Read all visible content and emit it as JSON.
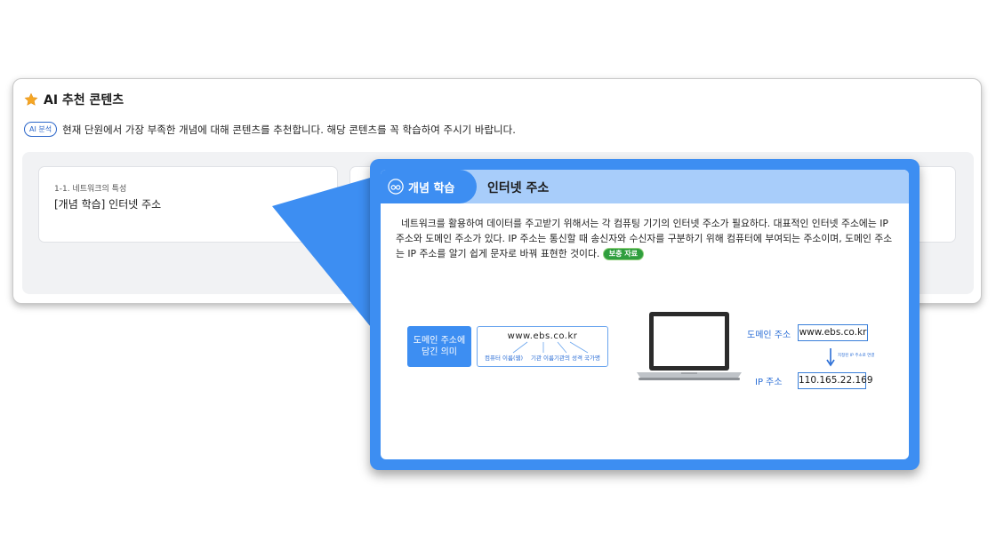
{
  "recommend": {
    "title": "AI 추천 콘텐츠",
    "badge": "AI 분석",
    "description": "현재 단원에서 가장 부족한 개념에 대해 콘텐츠를 추천합니다. 해당 콘텐츠를 꼭 학습하여 주시기 바랍니다.",
    "cards": [
      {
        "section": "1-1. 네트워크의 특성",
        "title": "[개념 학습] 인터넷 주소"
      }
    ]
  },
  "popup": {
    "tag": "개념 학습",
    "title": "인터넷 주소",
    "body": "네트워크를 활용하여 데이터를 주고받기 위해서는 각 컴퓨팅 기기의 인터넷 주소가 필요하다. 대표적인 인터넷 주소에는 IP 주소와 도메인 주소가 있다. IP 주소는 통신할 때 송신자와 수신자를 구분하기 위해 컴퓨터에 부여되는 주소이며, 도메인 주소는 IP 주소를 알기 쉽게 문자로 바꿔 표현한 것이다.",
    "extra_button": "보충 자료",
    "diagram": {
      "meaning_line1": "도메인 주소에",
      "meaning_line2": "담긴 의미",
      "url": "www.ebs.co.kr",
      "parts": [
        "컴퓨터 이름(웹)",
        "기관 이름",
        "기관의 성격",
        "국가명"
      ],
      "domain_label": "도메인 주소",
      "domain_value": "www.ebs.co.kr",
      "ip_label": "IP 주소",
      "ip_value": "110.165.22.169",
      "linked_note": "지정된 IP 주소로 연결"
    }
  },
  "colors": {
    "accent": "#3d8ef2",
    "header_bg": "#a8cdfa",
    "star": "#f5a623",
    "extra_button": "#2f9e3e"
  }
}
